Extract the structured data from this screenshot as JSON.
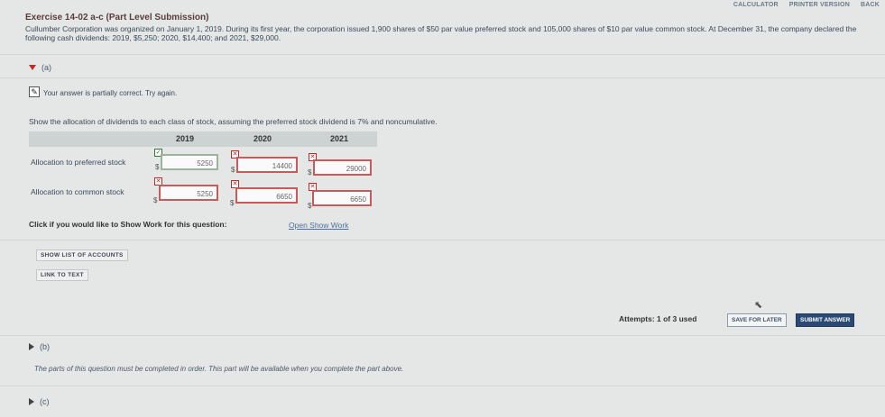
{
  "toolbar": {
    "calculator": "CALCULATOR",
    "printer_version": "PRINTER VERSION",
    "back": "BACK"
  },
  "exercise": {
    "title": "Exercise 14-02 a-c (Part Level Submission)",
    "text": "Cullumber Corporation was organized on January 1, 2019. During its first year, the corporation issued 1,900 shares of $50 par value preferred stock and 105,000 shares of $10 par value common stock. At December 31, the company declared the following cash dividends: 2019, $5,250; 2020, $14,400; and 2021, $29,000."
  },
  "part_a": {
    "label": "(a)",
    "status": "Your answer is partially correct.  Try again.",
    "instruction": "Show the allocation of dividends to each class of stock, assuming the preferred stock dividend is 7% and noncumulative.",
    "years": [
      "2019",
      "2020",
      "2021"
    ],
    "rows": [
      {
        "label": "Allocation to preferred stock",
        "values": [
          "5250",
          "14400",
          "29000"
        ]
      },
      {
        "label": "Allocation to common stock",
        "values": [
          "5250",
          "6650",
          "6650"
        ]
      }
    ],
    "currency": "$",
    "show_work_label": "Click if you would like to Show Work for this question:",
    "show_work_link": "Open Show Work"
  },
  "buttons": {
    "show_list": "SHOW LIST OF ACCOUNTS",
    "link_to_text": "LINK TO TEXT",
    "save_later": "SAVE FOR LATER",
    "submit": "SUBMIT ANSWER"
  },
  "attempts": "Attempts: 1 of 3 used",
  "part_b": {
    "label": "(b)",
    "note": "The parts of this question must be completed in order. This part will be available when you complete the part above."
  },
  "part_c": {
    "label": "(c)"
  },
  "colors": {
    "incorrect": "#c62828",
    "correct": "#2e7d32",
    "submit_bg": "#2a4a74"
  }
}
